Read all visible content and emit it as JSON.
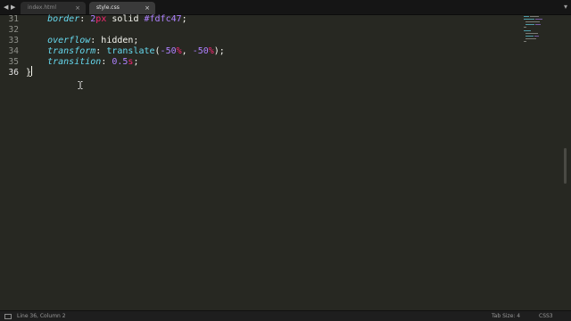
{
  "tabs": {
    "nav_back": "◀",
    "nav_forward": "▶",
    "inactive": {
      "label": "index.html",
      "close": "×"
    },
    "active": {
      "label": "style.css",
      "close": "×"
    },
    "menu": "▾"
  },
  "editor": {
    "line_numbers": [
      "31",
      "32",
      "33",
      "34",
      "35",
      "36"
    ],
    "current_line": "36",
    "lines": [
      [
        {
          "t": "    ",
          "c": "plain"
        },
        {
          "t": "border",
          "c": "prop"
        },
        {
          "t": ": ",
          "c": "plain"
        },
        {
          "t": "2",
          "c": "num"
        },
        {
          "t": "px",
          "c": "unit"
        },
        {
          "t": " solid ",
          "c": "plain"
        },
        {
          "t": "#fdfc47",
          "c": "num"
        },
        {
          "t": ";",
          "c": "plain"
        }
      ],
      [],
      [
        {
          "t": "    ",
          "c": "plain"
        },
        {
          "t": "overflow",
          "c": "prop"
        },
        {
          "t": ": hidden;",
          "c": "plain"
        }
      ],
      [
        {
          "t": "    ",
          "c": "plain"
        },
        {
          "t": "transform",
          "c": "prop"
        },
        {
          "t": ": ",
          "c": "plain"
        },
        {
          "t": "translate",
          "c": "fn"
        },
        {
          "t": "(",
          "c": "plain"
        },
        {
          "t": "-50",
          "c": "num"
        },
        {
          "t": "%",
          "c": "unit"
        },
        {
          "t": ", ",
          "c": "plain"
        },
        {
          "t": "-50",
          "c": "num"
        },
        {
          "t": "%",
          "c": "unit"
        },
        {
          "t": ");",
          "c": "plain"
        }
      ],
      [
        {
          "t": "    ",
          "c": "plain"
        },
        {
          "t": "transition",
          "c": "prop"
        },
        {
          "t": ": ",
          "c": "plain"
        },
        {
          "t": "0.5",
          "c": "num"
        },
        {
          "t": "s",
          "c": "unit"
        },
        {
          "t": ";",
          "c": "plain"
        }
      ],
      [
        {
          "t": "}",
          "c": "brace"
        }
      ]
    ]
  },
  "status": {
    "position": "Line 36, Column 2",
    "tab_size": "Tab Size: 4",
    "syntax": "CSS3"
  },
  "colors": {
    "background": "#272822",
    "property": "#66d9ef",
    "number": "#ae81ff",
    "unit": "#f92672",
    "text": "#f8f8f2"
  }
}
